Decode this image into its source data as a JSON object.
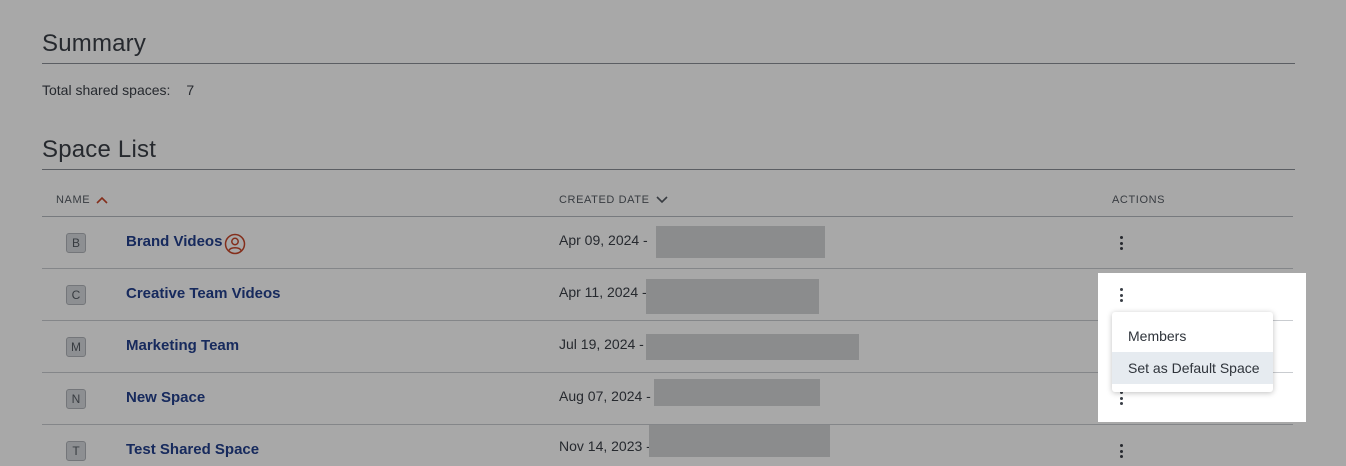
{
  "summary": {
    "title": "Summary",
    "total_label": "Total shared spaces:",
    "total_value": "7"
  },
  "space_list": {
    "title": "Space List",
    "columns": {
      "name": "NAME",
      "created": "CREATED DATE",
      "actions": "ACTIONS"
    },
    "rows": [
      {
        "initial": "B",
        "name": "Brand Videos",
        "date": "Apr 09, 2024 -",
        "owner": true
      },
      {
        "initial": "C",
        "name": "Creative Team Videos",
        "date": "Apr 11, 2024 -",
        "owner": false
      },
      {
        "initial": "M",
        "name": "Marketing Team",
        "date": "Jul 19, 2024 -",
        "owner": false
      },
      {
        "initial": "N",
        "name": "New Space",
        "date": "Aug 07, 2024 -",
        "owner": false
      },
      {
        "initial": "T",
        "name": "Test Shared Space",
        "date": "Nov 14, 2023 -",
        "owner": false
      }
    ]
  },
  "context_menu": {
    "items": [
      "Members",
      "Set as Default Space"
    ]
  },
  "colors": {
    "link": "#23408e",
    "sort_active": "#c8472a",
    "overlay": "#000000"
  },
  "icons": {
    "sort_name": "chevron-up-icon",
    "sort_date": "chevron-down-icon",
    "owner": "user-circle-icon",
    "actions": "kebab-menu-icon"
  }
}
